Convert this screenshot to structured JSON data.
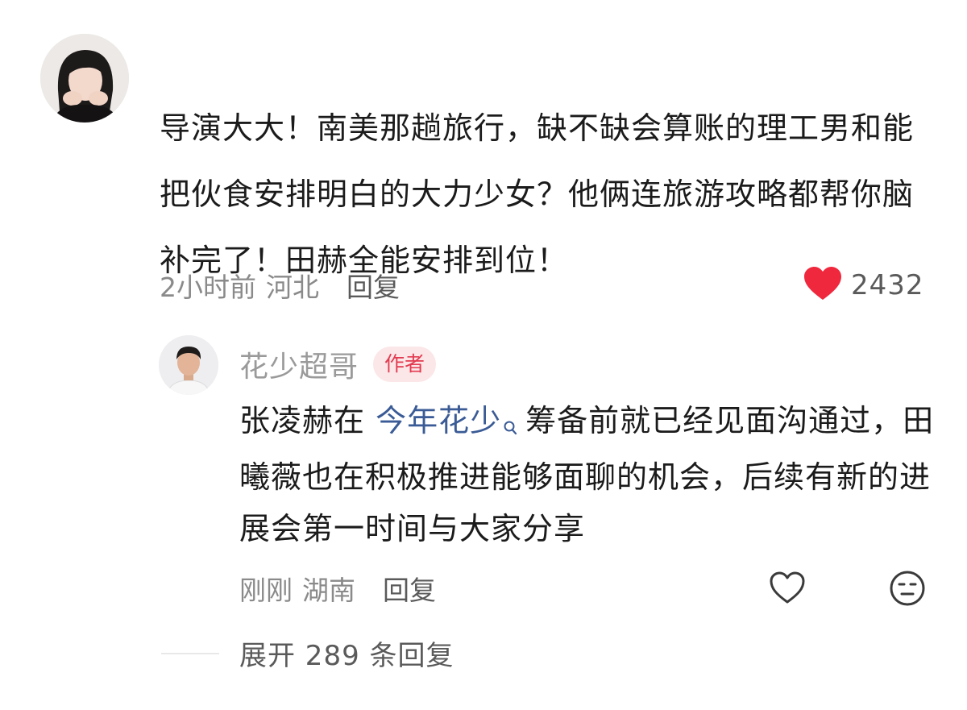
{
  "comment": {
    "text": "导演大大！南美那趟旅行，缺不缺会算账的理工男和能把伙食安排明白的大力少女？他俩连旅游攻略都帮你脑补完了！田赫全能安排到位！",
    "time": "2小时前",
    "location": "河北",
    "reply_label": "回复",
    "like_count": "2432",
    "like_color": "#f0283d"
  },
  "reply": {
    "author": "花少超哥",
    "badge": "作者",
    "text_before": "张凌赫在 ",
    "link_text": "今年花少",
    "text_after": "筹备前就已经见面沟通过，田曦薇也在积极推进能够面聊的机会，后续有新的进展会第一时间与大家分享",
    "time": "刚刚",
    "location": "湖南",
    "reply_label": "回复",
    "badge_color": "#e23b50"
  },
  "expand": {
    "label": "展开 289 条回复"
  },
  "icons": {
    "liked": "heart-filled-icon",
    "like": "heart-outline-icon",
    "dislike": "dislike-face-icon",
    "search": "search-icon"
  }
}
